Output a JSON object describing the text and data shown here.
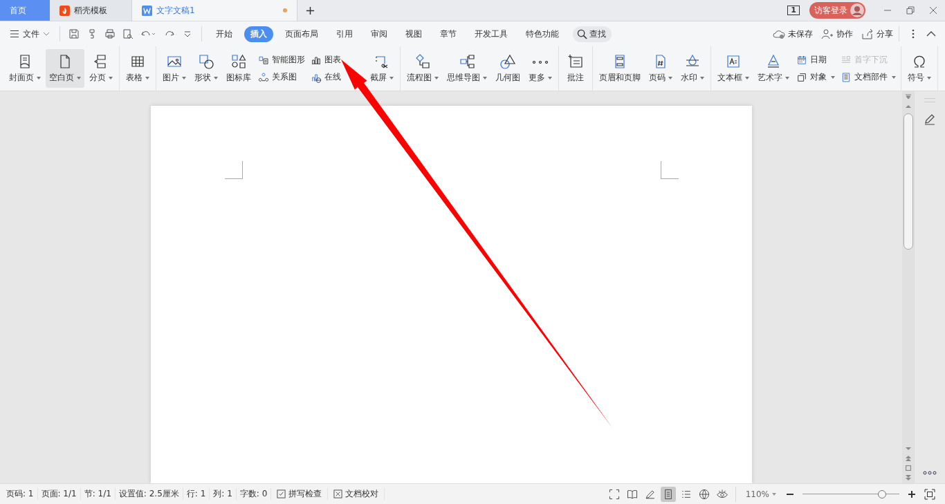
{
  "tabs": [
    {
      "label": "首页",
      "kind": "home",
      "selected": false
    },
    {
      "label": "稻壳模板",
      "kind": "store",
      "selected": false
    },
    {
      "label": "文字文稿1",
      "kind": "doc",
      "selected": true,
      "unsaved": true
    }
  ],
  "account": {
    "page_count": "1",
    "login": "访客登录"
  },
  "file_menu": "文件",
  "ribbon_tabs": [
    {
      "label": "开始",
      "selected": false
    },
    {
      "label": "插入",
      "selected": true
    },
    {
      "label": "页面布局",
      "selected": false
    },
    {
      "label": "引用",
      "selected": false
    },
    {
      "label": "审阅",
      "selected": false
    },
    {
      "label": "视图",
      "selected": false
    },
    {
      "label": "章节",
      "selected": false
    },
    {
      "label": "开发工具",
      "selected": false
    },
    {
      "label": "特色功能",
      "selected": false
    }
  ],
  "search": "查找",
  "right_actions": [
    "未保存",
    "协作",
    "分享"
  ],
  "ribbon_groups": [
    {
      "items": [
        {
          "kind": "large",
          "label": "封面页",
          "dropdown": true,
          "highlighted": false
        },
        {
          "kind": "large",
          "label": "空白页",
          "dropdown": true,
          "highlighted": true
        },
        {
          "kind": "large",
          "label": "分页",
          "dropdown": true,
          "highlighted": false
        }
      ]
    },
    {
      "items": [
        {
          "kind": "large",
          "label": "表格",
          "dropdown": true,
          "highlighted": false
        }
      ]
    },
    {
      "items": [
        {
          "kind": "large",
          "label": "图片",
          "dropdown": true,
          "highlighted": false
        },
        {
          "kind": "large",
          "label": "形状",
          "dropdown": true,
          "highlighted": false
        },
        {
          "kind": "large",
          "label": "图标库",
          "dropdown": false,
          "highlighted": false
        },
        {
          "kind": "stack",
          "rows": [
            {
              "label": "智能图形",
              "dropdown": false,
              "disabled": false
            },
            {
              "label": "关系图",
              "dropdown": false,
              "disabled": false
            }
          ]
        },
        {
          "kind": "stack",
          "rows": [
            {
              "label": "图表",
              "dropdown": false,
              "disabled": false
            },
            {
              "label": "在线",
              "dropdown": false,
              "disabled": false
            }
          ]
        },
        {
          "kind": "large",
          "label": "截屏",
          "dropdown": true,
          "highlighted": false
        }
      ]
    },
    {
      "items": [
        {
          "kind": "large",
          "label": "流程图",
          "dropdown": true,
          "highlighted": false
        },
        {
          "kind": "large",
          "label": "思维导图",
          "dropdown": true,
          "highlighted": false
        },
        {
          "kind": "large",
          "label": "几何图",
          "dropdown": false,
          "highlighted": false
        },
        {
          "kind": "large",
          "label": "更多",
          "dropdown": true,
          "highlighted": false
        }
      ]
    },
    {
      "items": [
        {
          "kind": "large",
          "label": "批注",
          "dropdown": false,
          "highlighted": false
        }
      ]
    },
    {
      "items": [
        {
          "kind": "large",
          "label": "页眉和页脚",
          "dropdown": false,
          "highlighted": false
        },
        {
          "kind": "large",
          "label": "页码",
          "dropdown": true,
          "highlighted": false
        },
        {
          "kind": "large",
          "label": "水印",
          "dropdown": true,
          "highlighted": false
        }
      ]
    },
    {
      "items": [
        {
          "kind": "large",
          "label": "文本框",
          "dropdown": true,
          "highlighted": false
        },
        {
          "kind": "large",
          "label": "艺术字",
          "dropdown": true,
          "highlighted": false
        },
        {
          "kind": "stack",
          "rows": [
            {
              "label": "日期",
              "dropdown": false,
              "disabled": false
            },
            {
              "label": "对象",
              "dropdown": true,
              "disabled": false
            }
          ]
        },
        {
          "kind": "stack",
          "rows": [
            {
              "label": "首字下沉",
              "dropdown": false,
              "disabled": true
            },
            {
              "label": "文档部件",
              "dropdown": true,
              "disabled": false
            }
          ]
        }
      ]
    },
    {
      "items": [
        {
          "kind": "large",
          "label": "符号",
          "dropdown": true,
          "highlighted": false
        }
      ]
    }
  ],
  "status_left": [
    "页码: 1",
    "页面: 1/1",
    "节: 1/1",
    "设置值: 2.5厘米",
    "行: 1",
    "列: 1",
    "字数: 0"
  ],
  "status_tools": [
    "拼写检查",
    "文档校对"
  ],
  "views": [
    {
      "selected": false
    },
    {
      "selected": false
    },
    {
      "selected": false
    },
    {
      "selected": true
    },
    {
      "selected": false
    },
    {
      "selected": false
    },
    {
      "selected": false
    }
  ],
  "zoom": {
    "value": "110%",
    "level": 0.82
  },
  "annotations": [
    {
      "kind": "arrow",
      "color": "#ff0000"
    }
  ]
}
